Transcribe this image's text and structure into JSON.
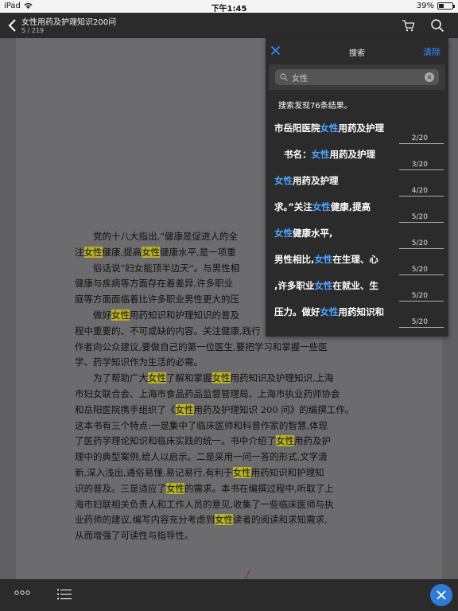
{
  "status_bar": {
    "device": "iPad",
    "time": "下午1:45",
    "battery": "39%",
    "battery_level": 0.39
  },
  "header": {
    "book_title": "女性用药及护理知识200问",
    "page_indicator": "5 / 219"
  },
  "search_panel": {
    "title": "搜索",
    "clear_label": "清除",
    "query": "女性",
    "summary": "搜索发现76条结果。",
    "results": [
      {
        "before": "市岳阳医院",
        "keyword": "女性",
        "after": "用药及护理",
        "location": "2/20"
      },
      {
        "before": "书名：",
        "keyword": "女性",
        "after": "用药及护理",
        "location": "3/20"
      },
      {
        "before": "",
        "keyword": "女性",
        "after": "用药及护理",
        "location": "4/20"
      },
      {
        "before": "求。”关注",
        "keyword": "女性",
        "after": "健康,提高",
        "location": "5/20"
      },
      {
        "before": "",
        "keyword": "女性",
        "after": "健康水平,",
        "location": "5/20"
      },
      {
        "before": "男性相比,",
        "keyword": "女性",
        "after": "在生理、心",
        "location": "5/20"
      },
      {
        "before": ",许多职业",
        "keyword": "女性",
        "after": "在就业、生",
        "location": "5/20"
      },
      {
        "before": "压力。做好",
        "keyword": "女性",
        "after": "用药知识和",
        "location": "5/20"
      }
    ]
  },
  "page_text": {
    "p1": [
      "党的十八大指出,“健康是促进人的全",
      "注",
      "女性",
      "健康,提高",
      "女性",
      "健康水平,是一项重"
    ],
    "p2": [
      "俗话说“妇女能顶半边天”。与男性相",
      "健康与疾病等方面存在着差异,许多职业",
      "庭等方面面临着比许多职业男性更大的压"
    ],
    "p3": [
      "做好",
      "女性",
      "用药知识和护理知识的普及",
      "程中重要的、不可或缺的内容。关注健康,践行",
      "作者向公众建议,要做自己的第一位医生,要把学习和掌握一些医",
      "学、药学知识作为生活的必需。"
    ],
    "p4": [
      "为了帮助广大",
      "女性",
      "了解和掌握",
      "女性",
      "用药知识及护理知识,上海",
      "市妇女联合会、上海市食品药品监督管理局、上海市执业药师协会",
      "和岳阳医院携手组织了《",
      "女性",
      "用药及护理知识 200 问》的编撰工作。",
      "这本书有三个特点:一是集中了临床医师和科普作家的智慧,体现",
      "了医药学理论知识和临床实践的统一。书中介绍了",
      "女性",
      "用药及护",
      "理中的典型案例,给人以启示。二是采用一问一答的形式,文字清",
      "新,深入浅出,通俗易懂,易记易行,有利于",
      "女性",
      "用药知识和护理知",
      "识的普及。三是适应了",
      "女性",
      "的需求。本书在编撰过程中,听取了上",
      "海市妇联相关负责人和工作人员的意见,收集了一些临床医师与执",
      "业药师的建议,编写内容充分考虑到",
      "女性",
      "读者的阅读和求知需求,",
      "从而增强了可读性与指导性。"
    ]
  },
  "bottom_bar": {
    "more_icon": "more-dots-icon",
    "toc_icon": "list-icon",
    "close_icon": "close-icon"
  },
  "colors": {
    "accent": "#2f8fff",
    "highlight": "#b8b12a",
    "fab": "#2f7bd6"
  }
}
